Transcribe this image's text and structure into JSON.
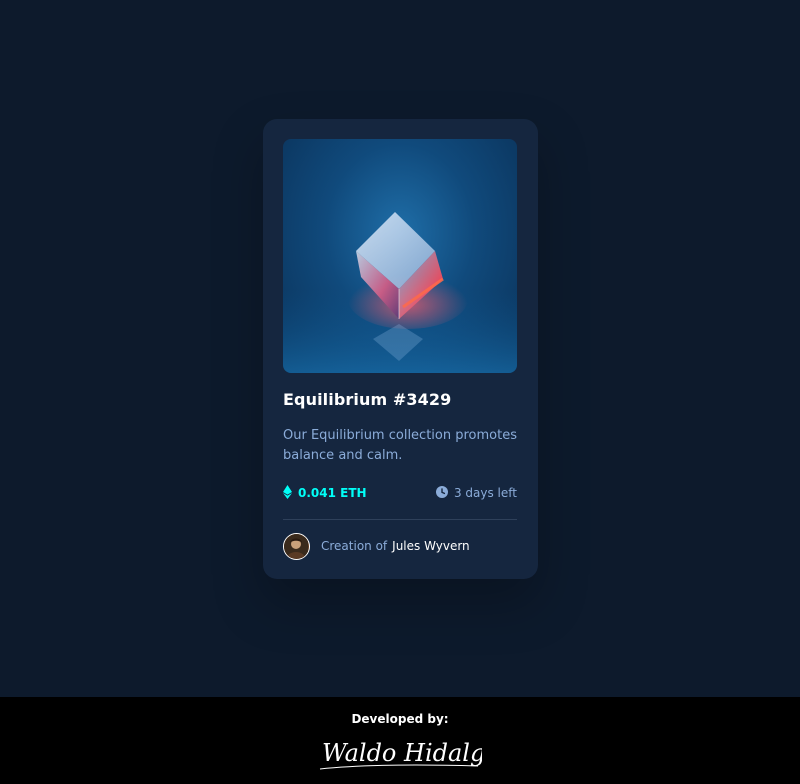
{
  "card": {
    "title": "Equilibrium #3429",
    "description": "Our Equilibrium collection promotes balance and calm.",
    "price": "0.041 ETH",
    "time_left": "3 days left",
    "creator_prefix": "Creation of",
    "creator_name": "Jules Wyvern",
    "image_name": "equilibrium-cube-artwork"
  },
  "footer": {
    "developed_by_label": "Developed by:",
    "signature_text": "Waldo Hidalgo"
  },
  "colors": {
    "page_bg": "#0d1a2c",
    "card_bg": "#15263f",
    "accent_cyan": "#00fff8",
    "soft_blue": "#8bacd9",
    "divider": "#2e405a",
    "footer_bg": "#000000"
  },
  "icons": {
    "price": "ethereum-icon",
    "time": "clock-icon"
  }
}
